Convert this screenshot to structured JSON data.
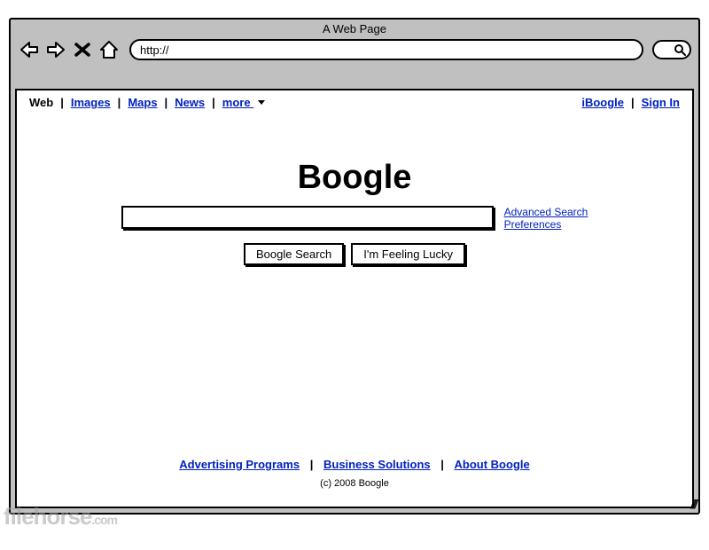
{
  "browser": {
    "title": "A Web Page",
    "url": "http://"
  },
  "nav": {
    "left": [
      "Web",
      "Images",
      "Maps",
      "News",
      "more"
    ],
    "right": [
      "iBoogle",
      "Sign In"
    ]
  },
  "logo": "Boogle",
  "side_links": {
    "advanced": "Advanced Search",
    "prefs": "Preferences"
  },
  "buttons": {
    "search": "Boogle Search",
    "lucky": "I'm Feeling Lucky"
  },
  "footer": {
    "links": [
      "Advertising Programs",
      "Business Solutions",
      "About Boogle"
    ],
    "copyright": "(c) 2008 Boogle"
  },
  "watermark": {
    "main": "filehorse",
    "suffix": ".com"
  }
}
